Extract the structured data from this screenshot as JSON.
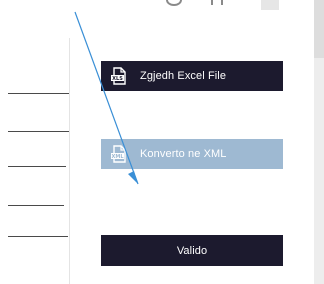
{
  "buttons": {
    "select_excel": {
      "label": "Zgjedh Excel File",
      "icon": "xls-file-icon"
    },
    "convert_xml": {
      "label": "Konverto ne XML",
      "icon": "xml-file-icon"
    },
    "validate": {
      "label": "Valido"
    }
  },
  "colors": {
    "dark_button": "#1c1a2e",
    "light_button": "#9eb9d2",
    "annotation_arrow": "#3a8fd6"
  }
}
